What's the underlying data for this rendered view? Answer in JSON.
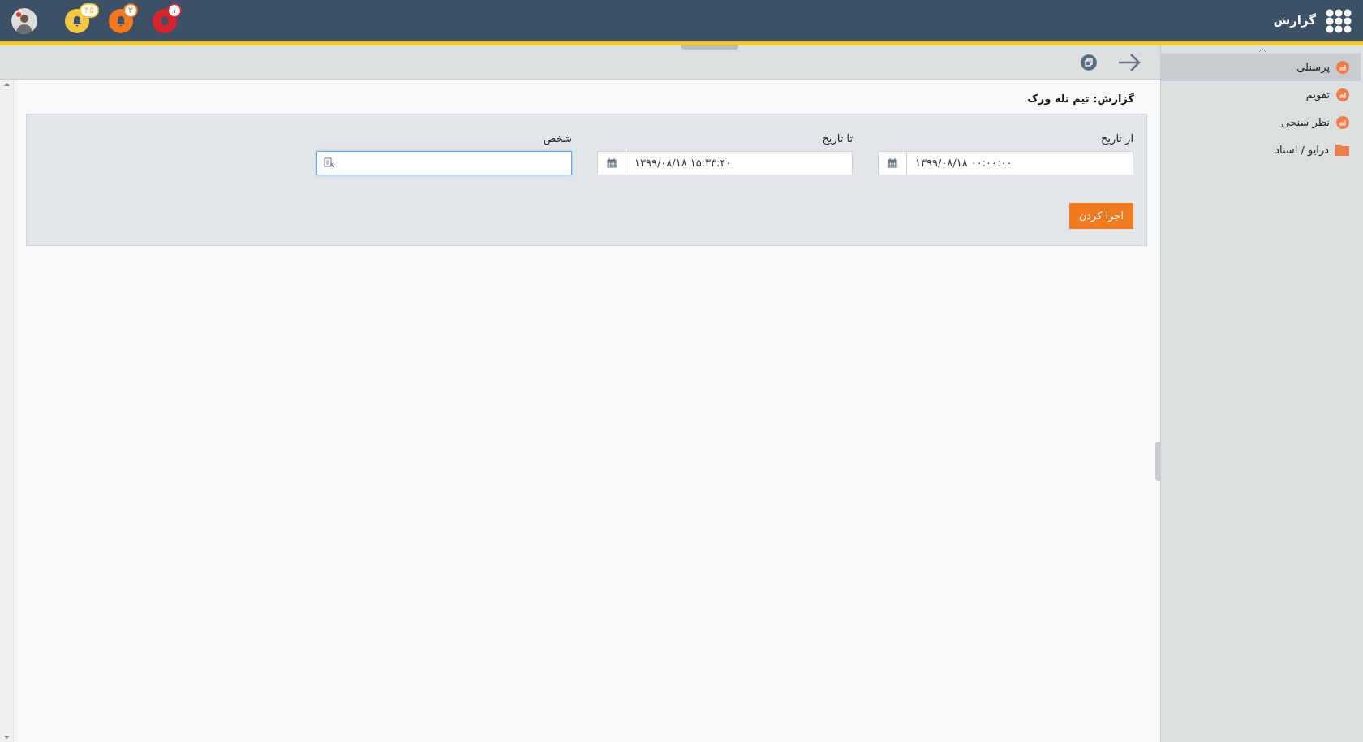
{
  "header": {
    "title": "گزارش",
    "notifications": [
      {
        "count": "۱",
        "color": "#d9232d"
      },
      {
        "count": "۲",
        "color": "#f47a20"
      },
      {
        "count": "۴۵",
        "color": "#f5c842"
      }
    ]
  },
  "sidebar": {
    "items": [
      {
        "label": "پرسنلی",
        "kind": "report",
        "selected": true
      },
      {
        "label": "تقویم",
        "kind": "report",
        "selected": false
      },
      {
        "label": "نظر سنجی",
        "kind": "report",
        "selected": false
      },
      {
        "label": "درایو / اسناد",
        "kind": "folder",
        "selected": false
      }
    ]
  },
  "report": {
    "title": "گزارش: تیم تله ورک",
    "fields": [
      {
        "label": "از تاریخ",
        "kind": "date",
        "value": "۱۳۹۹/۰۸/۱۸ ۰۰:۰۰:۰۰",
        "focused": false
      },
      {
        "label": "تا تاریخ",
        "kind": "date",
        "value": "۱۳۹۹/۰۸/۱۸ ۱۵:۳۳:۴۰",
        "focused": false
      },
      {
        "label": "شخص",
        "kind": "person",
        "focused": true
      }
    ],
    "run_button": "اجرا کردن"
  }
}
